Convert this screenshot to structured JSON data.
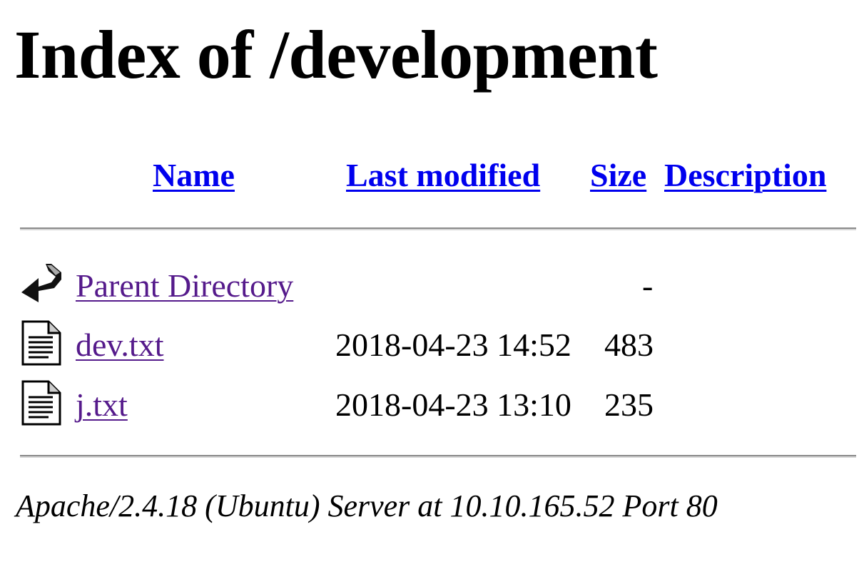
{
  "page": {
    "title": "Index of /development"
  },
  "table": {
    "columns": {
      "name": "Name",
      "last_modified": "Last modified",
      "size": "Size",
      "description": "Description"
    },
    "rows": [
      {
        "icon": "back-icon",
        "name": "Parent Directory",
        "modified": "",
        "size": "-",
        "description": ""
      },
      {
        "icon": "text-file-icon",
        "name": "dev.txt",
        "modified": "2018-04-23 14:52",
        "size": "483",
        "description": ""
      },
      {
        "icon": "text-file-icon",
        "name": "j.txt",
        "modified": "2018-04-23 13:10",
        "size": "235",
        "description": ""
      }
    ]
  },
  "footer": {
    "address": "Apache/2.4.18 (Ubuntu) Server at 10.10.165.52 Port 80"
  },
  "colors": {
    "link": "#0000ee",
    "visited_link": "#551a8b"
  }
}
